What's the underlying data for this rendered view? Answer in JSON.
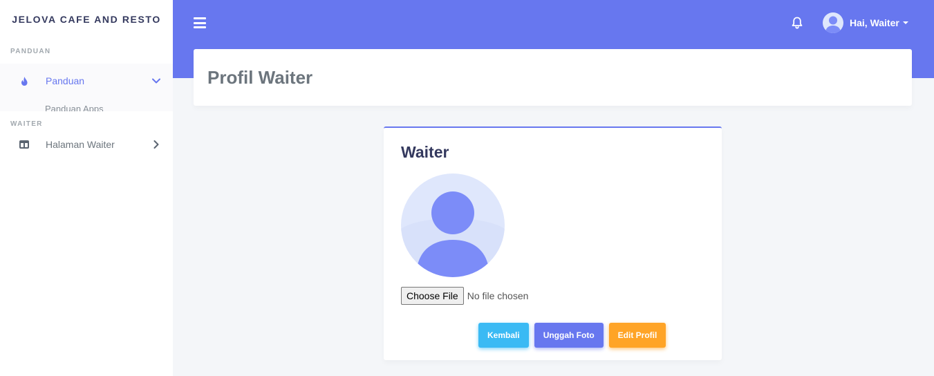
{
  "sidebar": {
    "brand": "JELOVA CAFE AND RESTO",
    "sections": [
      {
        "header": "PANDUAN",
        "item": {
          "label": "Panduan",
          "icon": "fire-icon",
          "expanded": true
        },
        "subitem": "Panduan Apps"
      },
      {
        "header": "WAITER",
        "item": {
          "label": "Halaman Waiter",
          "icon": "columns-icon",
          "expanded": false
        }
      }
    ]
  },
  "topbar": {
    "menu_icon": "hamburger-icon",
    "notification_icon": "bell-icon",
    "user_greeting": "Hai, Waiter"
  },
  "page": {
    "title": "Profil Waiter"
  },
  "profile_card": {
    "title": "Waiter",
    "file_input": {
      "button_label": "Choose File",
      "status": "No file chosen"
    },
    "buttons": {
      "back": "Kembali",
      "upload": "Unggah Foto",
      "edit": "Edit Profil"
    }
  },
  "colors": {
    "primary": "#6777ef",
    "info": "#3abaf4",
    "warning": "#ffa426",
    "background": "#f4f6f9"
  }
}
